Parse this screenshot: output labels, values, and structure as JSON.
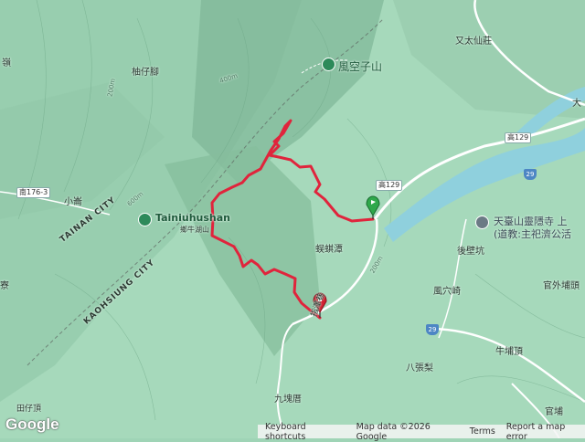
{
  "map": {
    "colors": {
      "terrain": "#9fd4b6",
      "river": "#8fd0dd",
      "track": "#e0243c",
      "road": "#ffffff"
    },
    "labels": [
      {
        "id": "youtaixian",
        "text": "又太仙莊"
      },
      {
        "id": "fengkongzi",
        "text": "風空子山"
      },
      {
        "id": "youzijiao",
        "text": "柚仔腳"
      },
      {
        "id": "xiaoqi",
        "text": "小崙"
      },
      {
        "id": "tainiuhushan",
        "text": "Tainiuhushan"
      },
      {
        "id": "tainiuhushan_zh",
        "text": "鄉牛湖山"
      },
      {
        "id": "tainan_city",
        "text": "TAINAN CITY"
      },
      {
        "id": "kaohsiung_city",
        "text": "KAOHSIUNG CITY"
      },
      {
        "id": "tiantai",
        "text": "天臺山靈隱寺 上"
      },
      {
        "id": "tiantai2",
        "text": "(道教:主祀濟公活"
      },
      {
        "id": "houbikeng",
        "text": "後壁坑"
      },
      {
        "id": "guanwaipu",
        "text": "官外埔頭"
      },
      {
        "id": "fengxueqi",
        "text": "風穴崎"
      },
      {
        "id": "wugongtan",
        "text": "蜈蜞潭"
      },
      {
        "id": "niupuding",
        "text": "牛埔頂"
      },
      {
        "id": "bazhangli",
        "text": "八張梨"
      },
      {
        "id": "jiukuicuo",
        "text": "九塊厝"
      },
      {
        "id": "guanpu",
        "text": "官埔"
      },
      {
        "id": "tianziding",
        "text": "田仔頂"
      },
      {
        "id": "da",
        "text": "大"
      },
      {
        "id": "ling",
        "text": "嶺"
      },
      {
        "id": "liao",
        "text": "寮"
      },
      {
        "id": "road_label",
        "text": "指澤巷"
      }
    ],
    "shields": [
      {
        "id": "s1",
        "text": "高129"
      },
      {
        "id": "s2",
        "text": "高129"
      },
      {
        "id": "s3",
        "text": "南176-3"
      }
    ],
    "highways": [
      {
        "id": "h1",
        "text": "29"
      },
      {
        "id": "h2",
        "text": "29"
      }
    ],
    "contours": [
      {
        "id": "c400",
        "text": "400m"
      },
      {
        "id": "c200a",
        "text": "200m"
      },
      {
        "id": "c200b",
        "text": "200m"
      },
      {
        "id": "c600",
        "text": "600m"
      }
    ],
    "icons": [
      "mountain-peak-icon",
      "temple-icon",
      "start-flag-icon",
      "end-pin-icon"
    ]
  },
  "footer": {
    "logo": "Google",
    "keyboard": "Keyboard shortcuts",
    "mapdata": "Map data ©2026 Google",
    "terms": "Terms",
    "report": "Report a map error"
  }
}
